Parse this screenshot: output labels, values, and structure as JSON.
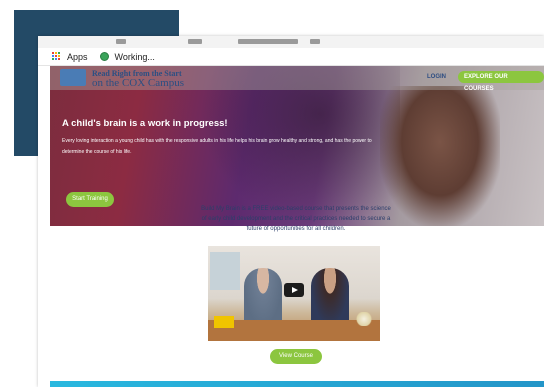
{
  "bookmarks": {
    "apps_label": "Apps",
    "working_label": "Working..."
  },
  "site": {
    "logo_line1": "Read Right from the Start",
    "logo_line2": "on the COX Campus",
    "nav_login": "LOGIN",
    "nav_explore": "EXPLORE OUR COURSES"
  },
  "hero": {
    "headline": "A child's brain is a work in progress!",
    "body": "Every loving interaction a young child has with the responsive adults in his life helps his brain grow healthy and strong, and has the power to determine the course of his life.",
    "cta_label": "Start Training"
  },
  "course": {
    "intro": "Build My Brain is a FREE video-based course that presents the science of early child development and the critical practices needed to secure a future of opportunities for all children.",
    "view_label": "View Course"
  },
  "colors": {
    "accent_green": "#8cc63f",
    "navy": "#2c4f83",
    "deco_navy": "#234a66"
  }
}
